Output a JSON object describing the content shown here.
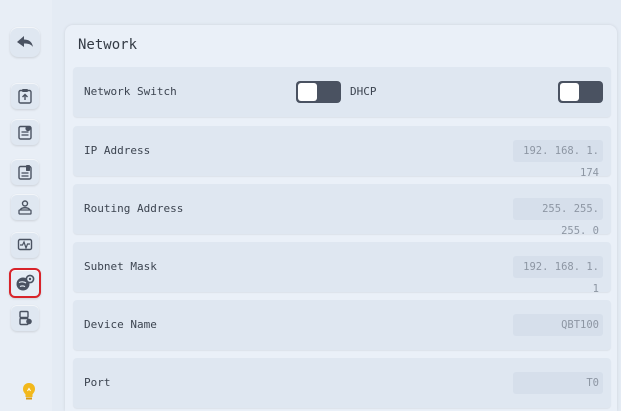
{
  "sidebar": {
    "items": [
      {
        "icon": "back-arrow-icon"
      },
      {
        "icon": "clipboard-upload-icon"
      },
      {
        "icon": "clipboard-settings-icon"
      },
      {
        "icon": "clipboard-battery-icon"
      },
      {
        "icon": "person-badge-icon"
      },
      {
        "icon": "monitor-wave-icon"
      },
      {
        "icon": "network-settings-icon",
        "selected": true
      },
      {
        "icon": "device-settings-icon"
      }
    ],
    "hint_icon": "lightbulb-icon"
  },
  "panel": {
    "title": "Network",
    "network_switch": {
      "label": "Network Switch",
      "enabled": false
    },
    "dhcp": {
      "label": "DHCP",
      "enabled": false
    },
    "fields": [
      {
        "label": "IP Address",
        "value": "192. 168. 1. 174"
      },
      {
        "label": "Routing Address",
        "value": "255. 255. 255. 0"
      },
      {
        "label": "Subnet Mask",
        "value": "192. 168. 1. 1"
      },
      {
        "label": "Device Name",
        "value": "QBT100"
      },
      {
        "label": "Port",
        "value": "T0"
      }
    ]
  },
  "colors": {
    "background": "#e4ebf4",
    "panel": "#eaf0f8",
    "row": "#dfe7f1",
    "toggle_off": "#4a5261",
    "selected_border": "#d8232a",
    "hint": "#f2b81c"
  }
}
